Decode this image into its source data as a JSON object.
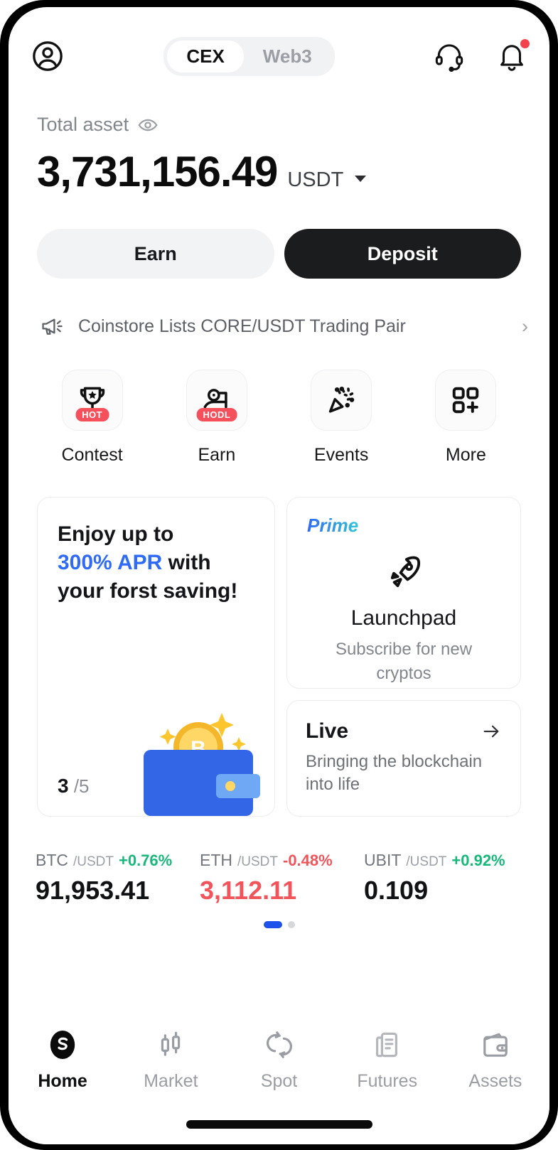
{
  "header": {
    "profile_icon": "user-circle-icon",
    "tabs": [
      {
        "label": "CEX",
        "active": true
      },
      {
        "label": "Web3",
        "active": false
      }
    ],
    "support_icon": "headset-icon",
    "notification_icon": "bell-icon",
    "has_notification_dot": true
  },
  "balance": {
    "label": "Total asset",
    "eye_icon": "eye-icon",
    "amount": "3,731,156.49",
    "currency": "USDT",
    "currency_caret": "chevron-down-icon"
  },
  "actions": {
    "earn_label": "Earn",
    "deposit_label": "Deposit"
  },
  "announcement": {
    "icon": "megaphone-icon",
    "text": "Coinstore Lists CORE/USDT Trading Pair",
    "arrow": "›"
  },
  "quick_actions": [
    {
      "label": "Contest",
      "icon": "trophy-icon",
      "badge": "HOT"
    },
    {
      "label": "Earn",
      "icon": "hodl-person-icon",
      "badge": "HODL"
    },
    {
      "label": "Events",
      "icon": "confetti-icon",
      "badge": ""
    },
    {
      "label": "More",
      "icon": "grid-plus-icon",
      "badge": ""
    }
  ],
  "promo_card": {
    "line1": "Enjoy up to",
    "accent": "300% APR",
    "line2_tail": " with",
    "line3": "your forst saving!",
    "counter_current": "3",
    "counter_total": "/5",
    "art": "wallet-bitcoin-illustration"
  },
  "launchpad_card": {
    "badge": "Prime",
    "icon": "rocket-icon",
    "title": "Launchpad",
    "subtitle": "Subscribe for new cryptos"
  },
  "live_card": {
    "title": "Live",
    "arrow_icon": "arrow-right-icon",
    "subtitle": "Bringing the blockchain into life"
  },
  "tickers": [
    {
      "base": "BTC",
      "quote": "/USDT",
      "change": "+0.76%",
      "price": "91,953.41",
      "direction": "up",
      "price_colored": false
    },
    {
      "base": "ETH",
      "quote": "/USDT",
      "change": "-0.48%",
      "price": "3,112.11",
      "direction": "down",
      "price_colored": true
    },
    {
      "base": "UBIT",
      "quote": "/USDT",
      "change": "+0.92%",
      "price": "0.109",
      "direction": "up",
      "price_colored": false
    }
  ],
  "pagination": {
    "pages": 2,
    "active_index": 0
  },
  "bottom_nav": [
    {
      "label": "Home",
      "icon": "coinstore-logo-icon",
      "active": true
    },
    {
      "label": "Market",
      "icon": "candlestick-icon",
      "active": false
    },
    {
      "label": "Spot",
      "icon": "swap-circles-icon",
      "active": false
    },
    {
      "label": "Futures",
      "icon": "document-icon",
      "active": false
    },
    {
      "label": "Assets",
      "icon": "wallet-icon",
      "active": false
    }
  ],
  "colors": {
    "accent_blue": "#2f6bf5",
    "up_green": "#18b87b",
    "down_red": "#f2545b",
    "badge_red": "#f5505c",
    "dark": "#1b1c1e"
  }
}
